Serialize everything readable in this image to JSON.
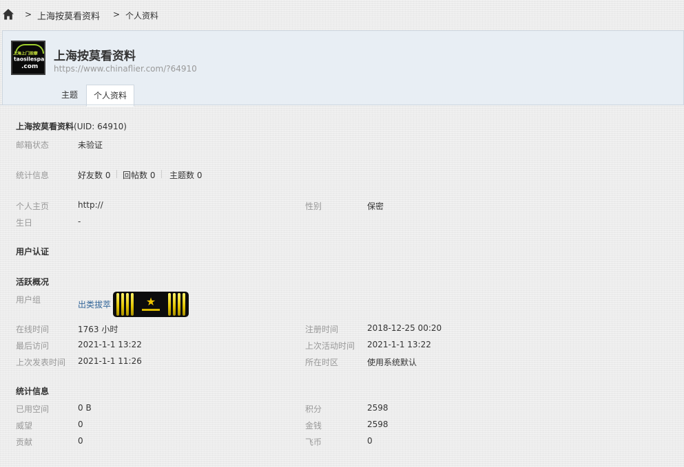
{
  "breadcrumb": {
    "separator": ">",
    "link": "上海按莫看资料",
    "current": "个人资料"
  },
  "header": {
    "avatar": {
      "line1": "上海上门按摩",
      "line2": "taosilespa",
      "line3": ".com"
    },
    "username": "上海按莫看资料",
    "url": "https://www.chinaflier.com/?64910",
    "tabs": [
      "主题",
      "个人资料"
    ]
  },
  "profile": {
    "name": "上海按莫看资料",
    "uid": "(UID: 64910)",
    "email_label": "邮箱状态",
    "email_value": "未验证",
    "stats_label": "统计信息",
    "friends": "好友数 0",
    "replies": "回帖数 0",
    "topics": "主题数 0",
    "homepage_label": "个人主页",
    "homepage_value": "http://",
    "gender_label": "性别",
    "gender_value": "保密",
    "birthday_label": "生日",
    "birthday_value": "-"
  },
  "user_auth": {
    "heading": "用户认证"
  },
  "activity": {
    "heading": "活跃概况",
    "group_label": "用户组",
    "group_value": "出类拔萃",
    "online_label": "在线时间",
    "online_value": "1763 小时",
    "register_label": "注册时间",
    "register_value": "2018-12-25 00:20",
    "last_visit_label": "最后访问",
    "last_visit_value": "2021-1-1 13:22",
    "last_active_label": "上次活动时间",
    "last_active_value": "2021-1-1 13:22",
    "last_post_label": "上次发表时间",
    "last_post_value": "2021-1-1 11:26",
    "timezone_label": "所在时区",
    "timezone_value": "使用系统默认"
  },
  "statistics": {
    "heading": "统计信息",
    "space_label": "已用空间",
    "space_value": "0 B",
    "points_label": "积分",
    "points_value": "2598",
    "prestige_label": "威望",
    "prestige_value": "0",
    "money_label": "金钱",
    "money_value": "2598",
    "contribution_label": "贡献",
    "contribution_value": "0",
    "coins_label": "飞币",
    "coins_value": "0"
  },
  "colors": {
    "header_bg": "#e8eef4",
    "link": "#336699",
    "label": "#999999",
    "badge_gold": "#f0c400"
  },
  "icons": {
    "home": "home-icon",
    "badge_star": "star-icon"
  }
}
